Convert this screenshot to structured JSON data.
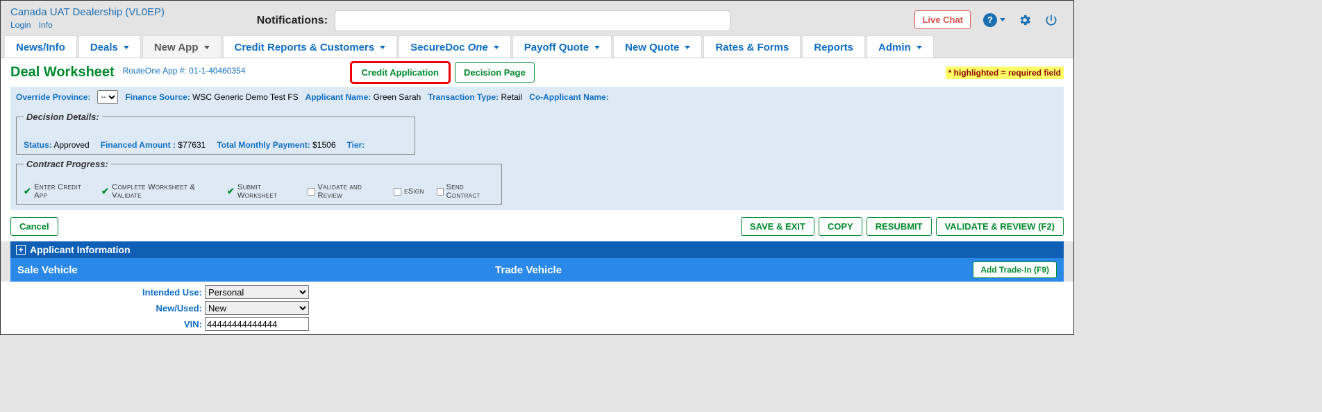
{
  "header": {
    "dealer": "Canada  UAT  Dealership  (VL0EP)",
    "login_link": "Login",
    "info_link": "Info",
    "notifications_label": "Notifications:",
    "live_chat": "Live Chat"
  },
  "nav": {
    "news": "News/Info",
    "deals": "Deals",
    "new_app": "New App",
    "credit": "Credit Reports & Customers",
    "secure_pre": "SecureDoc",
    "secure_em": "One",
    "payoff": "Payoff Quote",
    "new_quote": "New Quote",
    "rates": "Rates & Forms",
    "reports": "Reports",
    "admin": "Admin"
  },
  "page": {
    "title": "Deal Worksheet",
    "app_num": "RouteOne App #: 01-1-40460354",
    "btn_credit_app": "Credit Application",
    "btn_decision": "Decision Page",
    "req_note": "* highlighted = required field"
  },
  "summary": {
    "override_province_lbl": "Override Province:",
    "override_val": "--",
    "finance_source_lbl": "Finance Source:",
    "finance_source_val": "WSC Generic Demo Test FS",
    "applicant_lbl": "Applicant Name:",
    "applicant_val": "Green Sarah",
    "tx_type_lbl": "Transaction Type:",
    "tx_type_val": "Retail",
    "coapp_lbl": "Co-Applicant Name:",
    "coapp_val": ""
  },
  "decision": {
    "legend": "Decision Details:",
    "status_lbl": "Status:",
    "status_val": "Approved",
    "financed_lbl": "Financed Amount :",
    "financed_val": "$77631",
    "monthly_lbl": "Total Monthly Payment:",
    "monthly_val": "$1506",
    "tier_lbl": "Tier:"
  },
  "progress": {
    "legend": "Contract Progress:",
    "step1": "Enter Credit App",
    "step2": "Complete Worksheet & Validate",
    "step3": "Submit Worksheet",
    "step4": "Validate and Review",
    "step5": "eSign",
    "step6": "Send Contract"
  },
  "actions": {
    "cancel": "Cancel",
    "save_exit": "SAVE & EXIT",
    "copy": "COPY",
    "resubmit": "RESUBMIT",
    "validate": "VALIDATE & REVIEW (F2)"
  },
  "sections": {
    "applicant_info": "Applicant Information",
    "sale_vehicle": "Sale Vehicle",
    "trade_vehicle": "Trade Vehicle",
    "add_trade": "Add Trade-In (F9)"
  },
  "form": {
    "intended_use_lbl": "Intended Use:",
    "intended_use_val": "Personal",
    "new_used_lbl": "New/Used:",
    "new_used_val": "New",
    "vin_lbl": "VIN:",
    "vin_val": "44444444444444"
  }
}
